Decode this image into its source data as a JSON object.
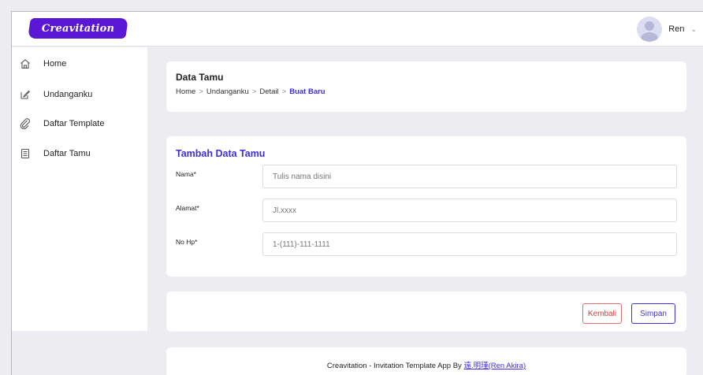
{
  "brand": {
    "logo_text": "Creavitation"
  },
  "user": {
    "name": "Ren",
    "caret": "⌄"
  },
  "sidebar": {
    "items": [
      {
        "label": "Home",
        "icon": "home-icon"
      },
      {
        "label": "Undanganku",
        "icon": "edit-icon"
      },
      {
        "label": "Daftar Template",
        "icon": "paperclip-icon"
      },
      {
        "label": "Daftar Tamu",
        "icon": "document-icon"
      }
    ]
  },
  "header": {
    "title": "Data Tamu",
    "breadcrumb": {
      "home": "Home",
      "undanganku": "Undanganku",
      "detail": "Detail",
      "current": "Buat Baru",
      "separator": ">"
    }
  },
  "form": {
    "title": "Tambah Data Tamu",
    "fields": [
      {
        "label": "Nama*",
        "placeholder": "Tulis nama disini",
        "value": ""
      },
      {
        "label": "Alamat*",
        "placeholder": "Jl.xxxx",
        "value": ""
      },
      {
        "label": "No Hp*",
        "placeholder": "1-(111)-111-1111",
        "value": ""
      }
    ]
  },
  "actions": {
    "back_label": "Kembali",
    "save_label": "Simpan"
  },
  "footer": {
    "text": "Creavitation - Invitation Template App By ",
    "author": "遠.明瑾(Ren Akira)"
  },
  "colors": {
    "accent": "#3d2ee0",
    "brand": "#5b17d6",
    "danger": "#d23b3b",
    "background": "#ececf1"
  }
}
